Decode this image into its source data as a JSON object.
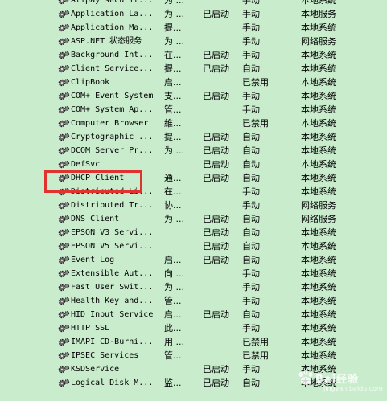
{
  "services": [
    {
      "name": "Alipay securit...",
      "description": "为 ...",
      "status": "",
      "startup": "手动",
      "logon_as": "本地系统"
    },
    {
      "name": "Application La...",
      "description": "为 ...",
      "status": "已启动",
      "startup": "手动",
      "logon_as": "本地服务"
    },
    {
      "name": "Application Ma...",
      "description": "提...",
      "status": "",
      "startup": "手动",
      "logon_as": "本地系统"
    },
    {
      "name": "ASP.NET 状态服务",
      "description": "为 ...",
      "status": "",
      "startup": "手动",
      "logon_as": "网络服务"
    },
    {
      "name": "Background Int...",
      "description": "在...",
      "status": "已启动",
      "startup": "手动",
      "logon_as": "本地系统"
    },
    {
      "name": "Client Service...",
      "description": "提...",
      "status": "已启动",
      "startup": "自动",
      "logon_as": "本地系统"
    },
    {
      "name": "ClipBook",
      "description": "启...",
      "status": "",
      "startup": "已禁用",
      "logon_as": "本地系统"
    },
    {
      "name": "COM+ Event System",
      "description": "支...",
      "status": "已启动",
      "startup": "手动",
      "logon_as": "本地系统"
    },
    {
      "name": "COM+ System Ap...",
      "description": "管...",
      "status": "",
      "startup": "手动",
      "logon_as": "本地系统"
    },
    {
      "name": "Computer Browser",
      "description": "維...",
      "status": "",
      "startup": "已禁用",
      "logon_as": "本地系统"
    },
    {
      "name": "Cryptographic ...",
      "description": "提...",
      "status": "已启动",
      "startup": "自动",
      "logon_as": "本地系统"
    },
    {
      "name": "DCOM Server Pr...",
      "description": "为 ...",
      "status": "已启动",
      "startup": "自动",
      "logon_as": "本地系统"
    },
    {
      "name": "DefSvc",
      "description": "",
      "status": "已启动",
      "startup": "自动",
      "logon_as": "本地系统"
    },
    {
      "name": "DHCP Client",
      "description": "通...",
      "status": "已启动",
      "startup": "自动",
      "logon_as": "本地系统"
    },
    {
      "name": "Distributed Li...",
      "description": "在...",
      "status": "",
      "startup": "手动",
      "logon_as": "本地系统"
    },
    {
      "name": "Distributed Tr...",
      "description": "协...",
      "status": "",
      "startup": "手动",
      "logon_as": "网络服务"
    },
    {
      "name": "DNS Client",
      "description": "为 ...",
      "status": "已启动",
      "startup": "自动",
      "logon_as": "网络服务"
    },
    {
      "name": "EPSON V3 Servi...",
      "description": "",
      "status": "已启动",
      "startup": "自动",
      "logon_as": "本地系统"
    },
    {
      "name": "EPSON V5 Servi...",
      "description": "",
      "status": "已启动",
      "startup": "自动",
      "logon_as": "本地系统"
    },
    {
      "name": "Event Log",
      "description": "启...",
      "status": "已启动",
      "startup": "自动",
      "logon_as": "本地系统"
    },
    {
      "name": "Extensible Aut...",
      "description": "向 ...",
      "status": "",
      "startup": "手动",
      "logon_as": "本地系统"
    },
    {
      "name": "Fast User Swit...",
      "description": "为 ...",
      "status": "",
      "startup": "手动",
      "logon_as": "本地系统"
    },
    {
      "name": "Health Key and...",
      "description": "管...",
      "status": "",
      "startup": "手动",
      "logon_as": "本地系统"
    },
    {
      "name": "HID Input Service",
      "description": "启...",
      "status": "已启动",
      "startup": "自动",
      "logon_as": "本地系统"
    },
    {
      "name": "HTTP SSL",
      "description": "此...",
      "status": "",
      "startup": "手动",
      "logon_as": "本地系统"
    },
    {
      "name": "IMAPI CD-Burni...",
      "description": "用 ...",
      "status": "",
      "startup": "已禁用",
      "logon_as": "本地系统"
    },
    {
      "name": "IPSEC Services",
      "description": "管...",
      "status": "",
      "startup": "已禁用",
      "logon_as": "本地系统"
    },
    {
      "name": "KSDService",
      "description": "",
      "status": "已启动",
      "startup": "手动",
      "logon_as": "本地系统"
    },
    {
      "name": "Logical Disk M...",
      "description": "监...",
      "status": "已启动",
      "startup": "自动",
      "logon_as": "本地系统"
    }
  ],
  "colors": {
    "background": "#c9eccd",
    "highlight": "#e0322f"
  },
  "icon": "gear-service-icon",
  "watermark": {
    "text": "Bai经验",
    "sub": "jingyan.baidu.com"
  }
}
